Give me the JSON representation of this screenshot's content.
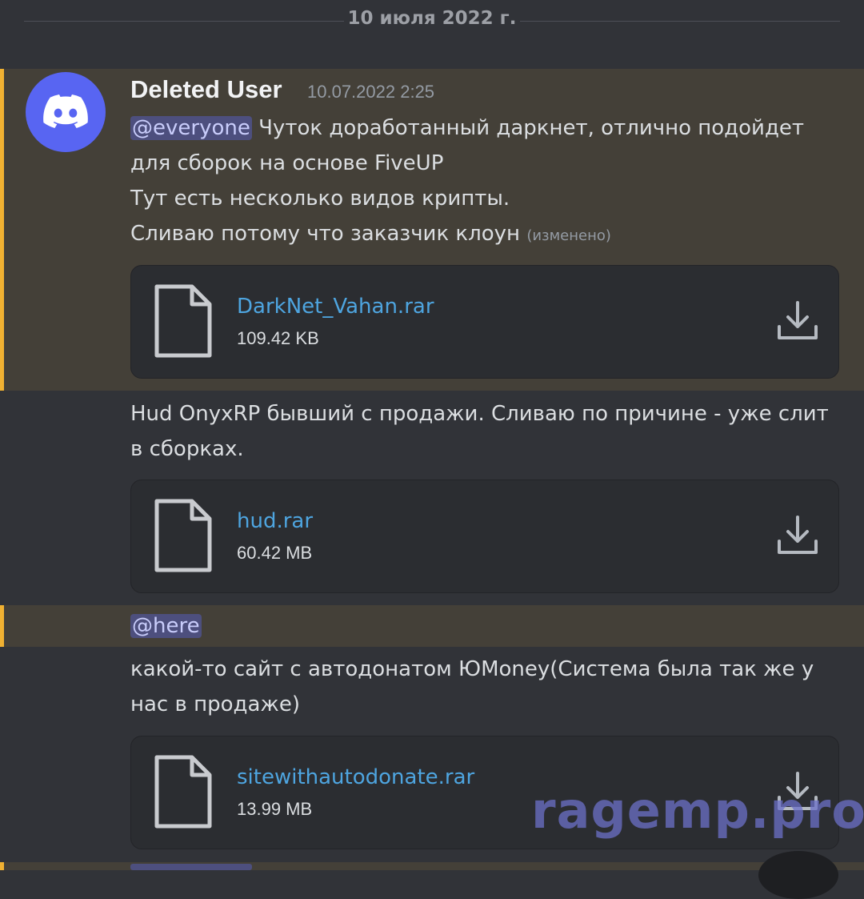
{
  "date_divider": "10 июля 2022 г.",
  "message": {
    "username": "Deleted User",
    "timestamp": "10.07.2022 2:25",
    "mention": "@everyone",
    "text_line1_rest": " Чуток доработанный даркнет, отлично подойдет",
    "text_line2": "для сборок на основе FiveUP",
    "text_line3": "Тут есть несколько видов крипты.",
    "text_line4": "Сливаю потому что заказчик клоун",
    "edited_label": "(изменено)"
  },
  "attachments": [
    {
      "name": "DarkNet_Vahan.rar",
      "size": "109.42 KB"
    },
    {
      "name": "hud.rar",
      "size": "60.42 MB"
    },
    {
      "name": "sitewithautodonate.rar",
      "size": "13.99 MB"
    }
  ],
  "message2": {
    "line1": "Hud OnyxRP бывший с продажи. Сливаю по причине - уже слит",
    "line2": "в сборках."
  },
  "message3": {
    "mention": "@here"
  },
  "message4": {
    "line1": "какой-то сайт с автодонатом ЮMoney(Система была так же у",
    "line2": "нас в продаже)"
  },
  "watermark": "ragemp.pro",
  "icons": {
    "avatar": "discord-logo-icon",
    "file": "file-icon",
    "download": "download-icon"
  },
  "colors": {
    "background": "#313338",
    "mention_highlight": "#444038",
    "mention_bar": "#f0b132",
    "link": "#4ea5e0",
    "avatar": "#5865f2"
  }
}
